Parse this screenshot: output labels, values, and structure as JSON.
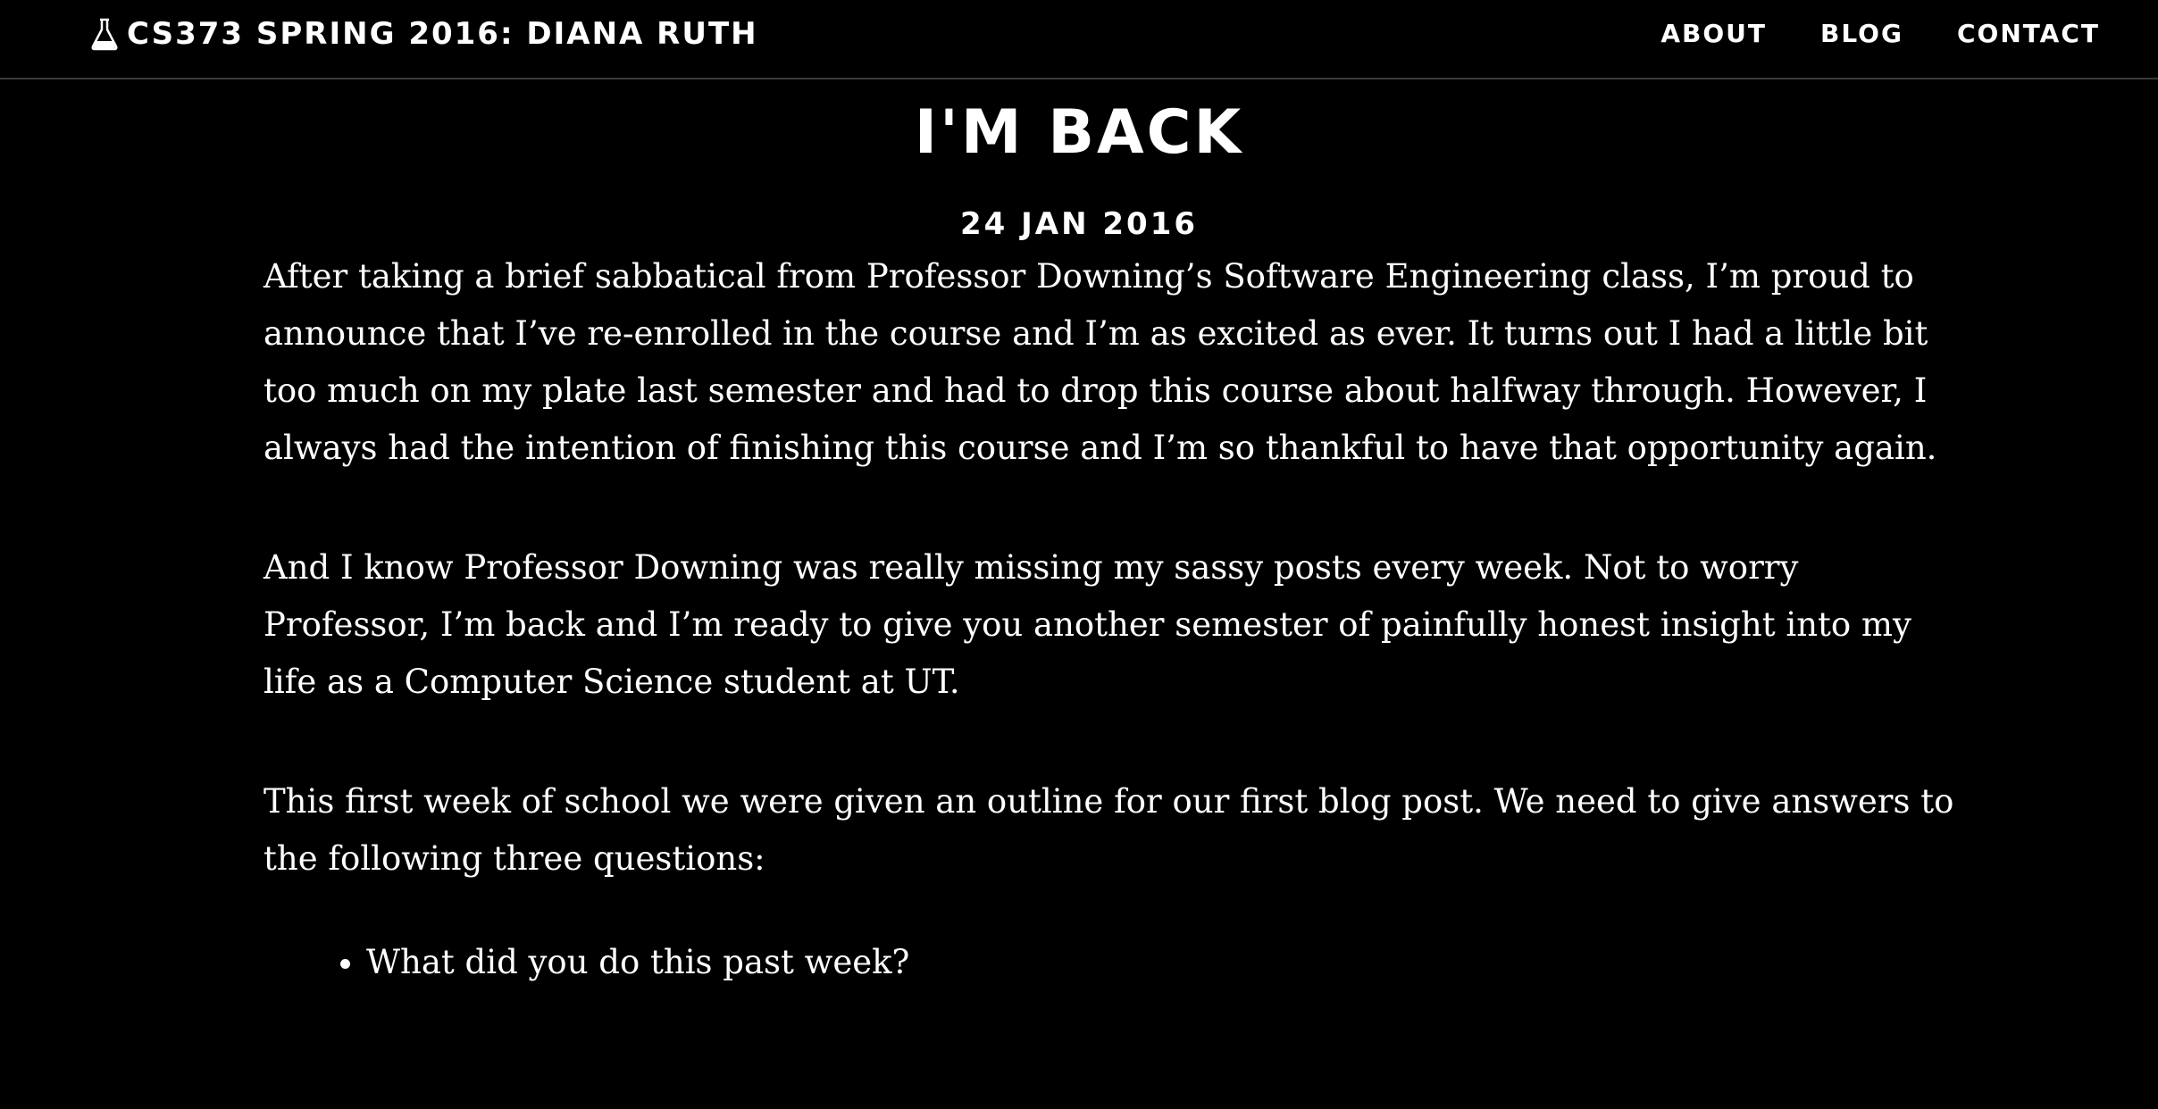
{
  "header": {
    "brand_icon": "flask-icon",
    "site_title": "CS373 SPRING 2016: DIANA RUTH",
    "nav": [
      {
        "label": "ABOUT"
      },
      {
        "label": "BLOG"
      },
      {
        "label": "CONTACT"
      }
    ]
  },
  "post": {
    "title": "I'M BACK",
    "date": "24 JAN 2016",
    "paragraphs": [
      "After taking a brief sabbatical from Professor Downing’s Software Engineering class, I’m proud to announce that I’ve re-enrolled in the course and I’m as excited as ever. It turns out I had a little bit too much on my plate last semester and had to drop this course about halfway through. However, I always had the intention of finishing this course and I’m so thankful to have that opportunity again.",
      "And I know Professor Downing was really missing my sassy posts every week. Not to worry Professor, I’m back and I’m ready to give you another semester of painfully honest insight into my life as a Computer Science student at UT.",
      "This first week of school we were given an outline for our first blog post. We need to give answers to the following three questions:"
    ],
    "questions": [
      "What did you do this past week?"
    ]
  },
  "colors": {
    "background": "#000000",
    "text": "#ffffff",
    "divider": "#3a3a3a"
  }
}
